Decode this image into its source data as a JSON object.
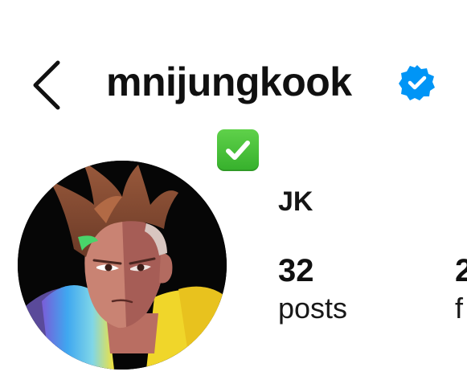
{
  "header": {
    "username": "mnijungkook",
    "verified_icon": "verified-badge-icon",
    "back_icon": "chevron-left-icon"
  },
  "profile": {
    "bio_emoji": "✅",
    "display_name": "JK",
    "avatar_icon": "profile-avatar-image"
  },
  "stats": [
    {
      "value": "32",
      "label": "posts"
    },
    {
      "value": "2",
      "label": "f"
    }
  ],
  "colors": {
    "verified_blue": "#0095f6",
    "check_green": "#45c23a",
    "text": "#111111"
  }
}
